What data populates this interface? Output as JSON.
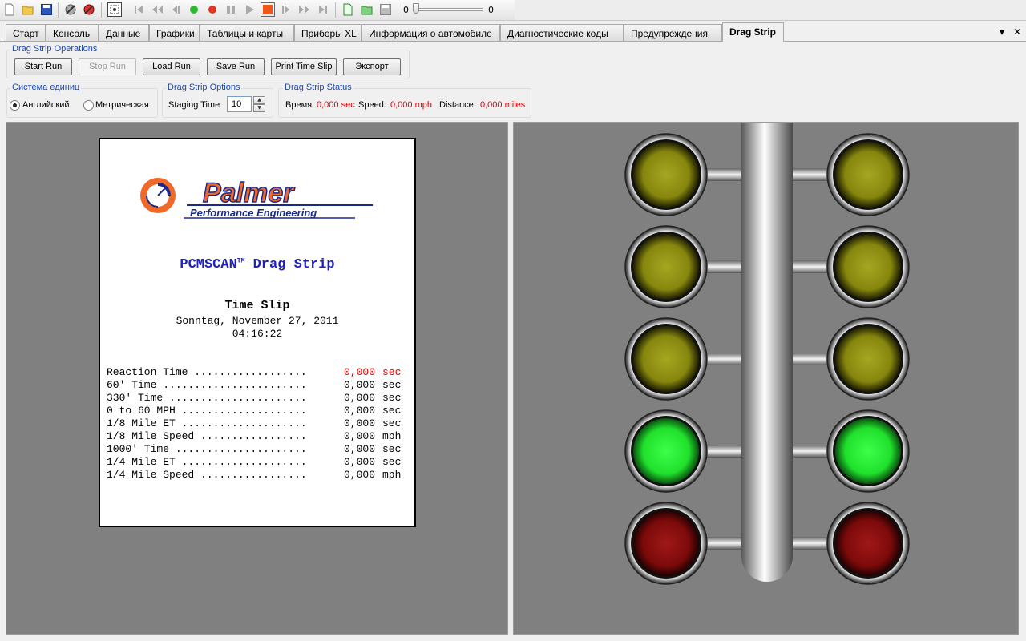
{
  "toolbar": {
    "icons": [
      "new-file-icon",
      "open-folder-icon",
      "save-icon",
      "disconnect-icon",
      "connect-icon",
      "select-icon",
      "first-icon",
      "rewind-icon",
      "step-back-icon",
      "play-green-icon",
      "record-icon",
      "pause-icon",
      "play-icon",
      "stop-icon",
      "step-forward-icon",
      "fast-forward-icon",
      "last-icon",
      "new-log-icon",
      "open-log-icon",
      "save-log-icon"
    ],
    "slider_min": "0",
    "slider_max": "0"
  },
  "tabs": [
    {
      "label": "Старт"
    },
    {
      "label": "Консоль"
    },
    {
      "label": "Данные"
    },
    {
      "label": "Графики"
    },
    {
      "label": "Таблицы и карты"
    },
    {
      "label": "Приборы XL"
    },
    {
      "label": "Информация о автомобиле"
    },
    {
      "label": "Диагностические коды"
    },
    {
      "label": "Предупреждения"
    },
    {
      "label": "Drag Strip",
      "active": true
    }
  ],
  "window_controls": {
    "menu": "▾",
    "close": "✕"
  },
  "operations": {
    "title": "Drag Strip Operations",
    "buttons": {
      "start": "Start Run",
      "stop": "Stop Run",
      "load": "Load Run",
      "save": "Save Run",
      "print": "Print Time Slip",
      "export": "Экспорт"
    }
  },
  "units": {
    "title": "Система единиц",
    "english": "Английский",
    "metric": "Метрическая",
    "selected": "english"
  },
  "options": {
    "title": "Drag Strip Options",
    "staging_label": "Staging Time:",
    "staging_value": "10"
  },
  "status": {
    "title": "Drag Strip Status",
    "time_label": "Время:",
    "time_value": "0,000 sec",
    "speed_label": "Speed:",
    "speed_value": "0,000 mph",
    "distance_label": "Distance:",
    "distance_value": "0,000 miles"
  },
  "slip": {
    "logo_text": "Palmer",
    "logo_subtext": "Performance Engineering",
    "title": "PCMSCAN",
    "title_tm": "TM",
    "title_rest": " Drag Strip",
    "heading": "Time Slip",
    "date": "Sonntag, November 27, 2011",
    "time": "04:16:22",
    "rows": [
      {
        "label": "Reaction Time ..................",
        "value": "0,000",
        "unit": "sec",
        "highlight": true
      },
      {
        "label": "60' Time .......................",
        "value": "0,000",
        "unit": "sec"
      },
      {
        "label": "330' Time ......................",
        "value": "0,000",
        "unit": "sec"
      },
      {
        "label": "0 to 60 MPH ....................",
        "value": "0,000",
        "unit": "sec"
      },
      {
        "label": "1/8 Mile ET ....................",
        "value": "0,000",
        "unit": "sec"
      },
      {
        "label": "1/8 Mile Speed .................",
        "value": "0,000",
        "unit": "mph"
      },
      {
        "label": "1000' Time .....................",
        "value": "0,000",
        "unit": "sec"
      },
      {
        "label": "1/4 Mile ET ....................",
        "value": "0,000",
        "unit": "sec"
      },
      {
        "label": "1/4 Mile Speed .................",
        "value": "0,000",
        "unit": "mph"
      }
    ]
  },
  "christmas_tree": {
    "lights": [
      {
        "row": "pre-stage",
        "state": "amber-off"
      },
      {
        "row": "stage",
        "state": "amber-off"
      },
      {
        "row": "amber",
        "state": "amber-off"
      },
      {
        "row": "green",
        "state": "green-on"
      },
      {
        "row": "red",
        "state": "red-off"
      }
    ],
    "colors": {
      "amber_off": "#8a8a10",
      "green_on": "#22ee33",
      "red_off": "#8a1010",
      "pane_bg": "#808080"
    }
  }
}
